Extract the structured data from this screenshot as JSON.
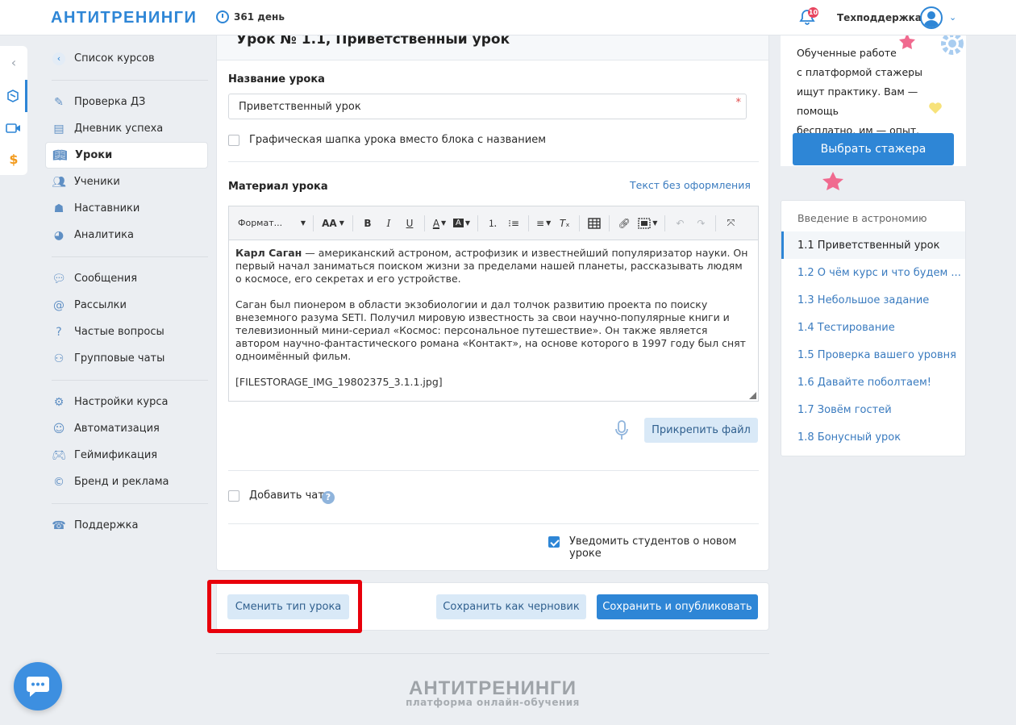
{
  "topbar": {
    "logo": "АНТИТРЕНИНГИ",
    "days": "361 день",
    "notifications_count": "10",
    "user_label": "Техподдержка"
  },
  "sidebar": {
    "back_label": "Список курсов",
    "groups": [
      [
        {
          "label": "Проверка ДЗ",
          "icon": "edit-icon"
        },
        {
          "label": "Дневник успеха",
          "icon": "diary-icon"
        },
        {
          "label": "Уроки",
          "icon": "book-icon",
          "active": true
        },
        {
          "label": "Ученики",
          "icon": "students-icon"
        },
        {
          "label": "Наставники",
          "icon": "mentors-icon"
        },
        {
          "label": "Аналитика",
          "icon": "pie-chart-icon"
        }
      ],
      [
        {
          "label": "Сообщения",
          "icon": "messages-icon"
        },
        {
          "label": "Рассылки",
          "icon": "at-icon"
        },
        {
          "label": "Частые вопросы",
          "icon": "question-icon"
        },
        {
          "label": "Групповые чаты",
          "icon": "group-chat-icon"
        }
      ],
      [
        {
          "label": "Настройки курса",
          "icon": "gear-icon"
        },
        {
          "label": "Автоматизация",
          "icon": "robot-icon"
        },
        {
          "label": "Геймификация",
          "icon": "gamepad-icon"
        },
        {
          "label": "Бренд и реклама",
          "icon": "copyright-icon"
        }
      ],
      [
        {
          "label": "Поддержка",
          "icon": "phone-icon"
        }
      ]
    ]
  },
  "lesson": {
    "header_title": "Урок № 1.1, Приветственный урок",
    "name_label": "Название урока",
    "name_value": "Приветственный урок",
    "required_mark": "*",
    "graphic_header_label": "Графическая шапка урока вместо блока с названием",
    "material_label": "Материал урока",
    "plain_text_link": "Текст без оформления",
    "toolbar_format": "Формат...",
    "toolbar_size": "AA",
    "editor": {
      "p1_bold": "Карл Саган",
      "p1_rest": " — американский астроном, астрофизик и известнейший популяризатор науки. Он первый начал заниматься поиском жизни за пределами нашей планеты, рассказывать людям о космосе, его секретах и его устройстве.",
      "p2": "Саган был пионером в области экзобиологии и дал толчок развитию проекта по поиску внеземного разума SETI. Получил мировую известность за свои научно-популярные книги и телевизионный мини-сериал «Космос: персональное путешествие». Он также является автором научно-фантастического романа «Контакт», на основе которого в 1997 году был снят одноимённый фильм.",
      "p3": "[FILESTORAGE_IMG_19802375_3.1.1.jpg]"
    },
    "attach_button": "Прикрепить файл",
    "add_chat_label": "Добавить чат",
    "notify_label": "Уведомить студентов о новом уроке"
  },
  "actions": {
    "change_type": "Сменить тип урока",
    "save_draft": "Сохранить как черновик",
    "save_publish": "Сохранить и опубликовать"
  },
  "footer": {
    "logo": "АНТИТРЕНИНГИ",
    "tagline": "платформа онлайн-обучения"
  },
  "promo": {
    "line1": "Обученные работе",
    "line2": "с платформой стажеры",
    "line3": "ищут практику. Вам — помощь",
    "line4": "бесплатно, им — опыт.",
    "button": "Выбрать стажера"
  },
  "outline": {
    "course_title": "Введение в астрономию",
    "items": [
      "1.1 Приветственный урок",
      "1.2 О чём курс и что будем ...",
      "1.3 Небольшое задание",
      "1.4 Тестирование",
      "1.5 Проверка вашего уровня",
      "1.6 Давайте поболтаем!",
      "1.7 Зовём гостей",
      "1.8 Бонусный урок"
    ],
    "active_index": 0
  },
  "colors": {
    "accent": "#2e86d6",
    "highlight": "#e8000b",
    "link": "#3a7bbf"
  }
}
